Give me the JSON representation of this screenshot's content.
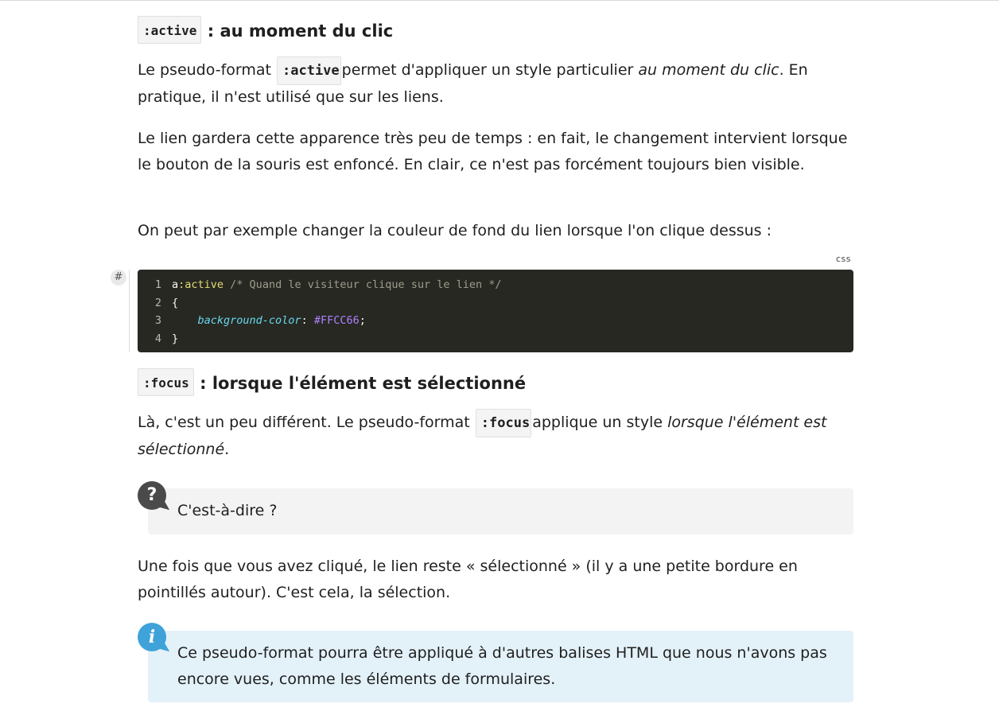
{
  "section_active": {
    "code": ":active",
    "title": " : au moment du clic"
  },
  "para_active_1": {
    "before": "Le pseudo-format ",
    "code": ":active",
    "middle": "permet d'appliquer un style particulier ",
    "emphasis": "au moment du clic",
    "after": ". En pratique, il n'est utilisé que sur les liens."
  },
  "para_active_2": "Le lien gardera cette apparence très peu de temps : en fait, le changement intervient lorsque le bouton de la souris est enfoncé. En clair, ce n'est pas forcément toujours bien visible.",
  "para_active_3": "On peut par exemple changer la couleur de fond du lien lorsque l'on clique dessus :",
  "code_block": {
    "language": "css",
    "anchor_symbol": "#",
    "lines": [
      {
        "number": "1",
        "selector": "a",
        "pseudo": ":active",
        "comment": " /* Quand le visiteur clique sur le lien */"
      },
      {
        "number": "2",
        "text": "{"
      },
      {
        "number": "3",
        "indent": "    ",
        "property": "background-color",
        "colon": ": ",
        "value": "#FFCC66",
        "end": ";"
      },
      {
        "number": "4",
        "text": "}"
      }
    ]
  },
  "section_focus": {
    "code": ":focus",
    "title": " : lorsque l'élément est sélectionné"
  },
  "para_focus_1": {
    "before": "Là, c'est un peu différent. Le pseudo-format ",
    "code": ":focus",
    "middle": "applique un style ",
    "emphasis": "lorsque l'élément est sélectionné",
    "after": "."
  },
  "callout_question": {
    "icon": "?",
    "text": "C'est-à-dire ?"
  },
  "para_focus_2": "Une fois que vous avez cliqué, le lien reste « sélectionné » (il y a une petite bordure en pointillés autour). C'est cela, la sélection.",
  "callout_info": {
    "icon": "i",
    "text": "Ce pseudo-format pourra être appliqué à d'autres balises HTML que nous n'avons pas encore vues, comme les éléments de formulaires."
  },
  "colors": {
    "code_background": "#272822",
    "question_callout_bg": "#f3f3f3",
    "info_callout_bg": "#e3f1f9",
    "info_icon": "#3fa2d9",
    "question_icon": "#4a4a4a"
  }
}
